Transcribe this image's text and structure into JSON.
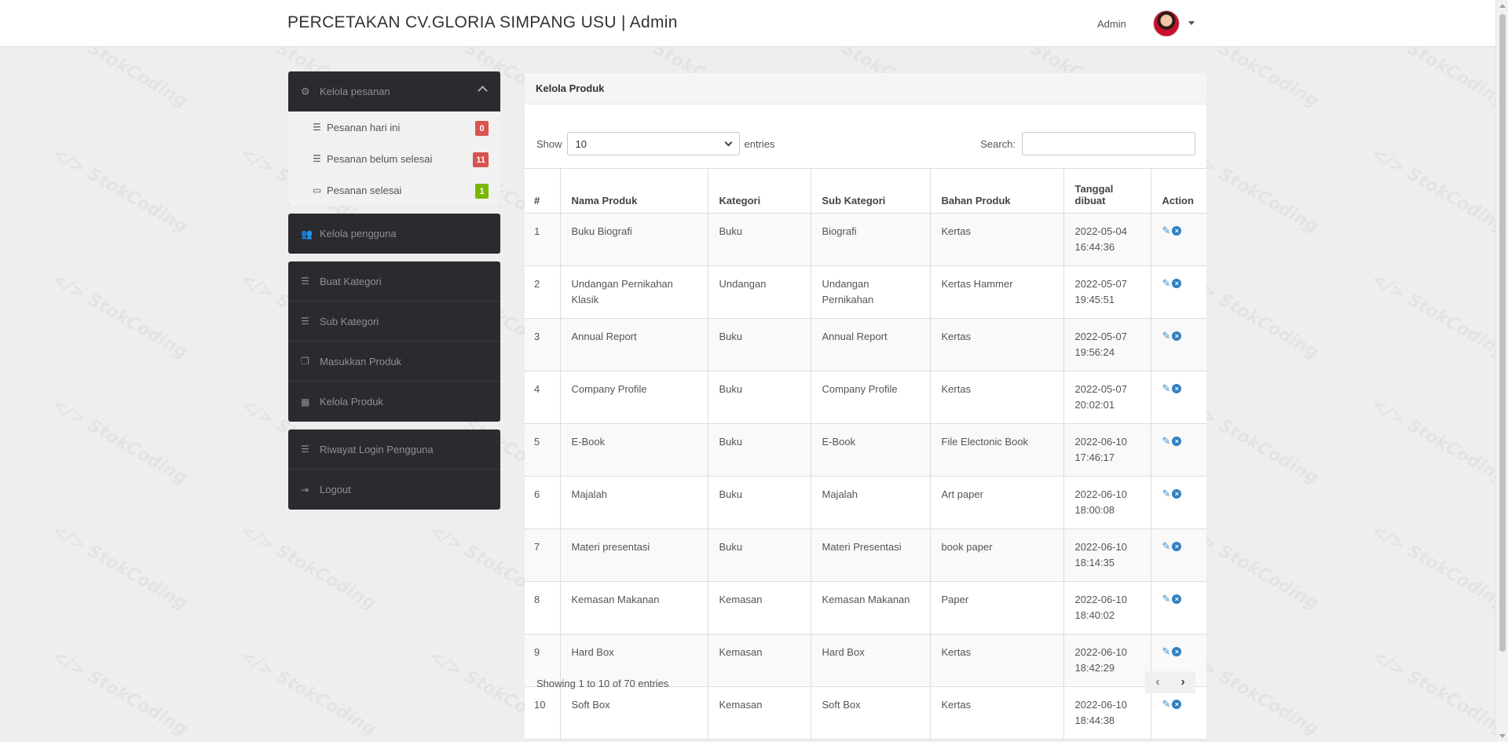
{
  "header": {
    "brand": "PERCETAKAN CV.GLORIA SIMPANG USU | Admin",
    "user": "Admin"
  },
  "watermark": "</> StokCoding",
  "sidebar": {
    "orders": {
      "label": "Kelola pesanan",
      "icon": "gear-icon",
      "items": [
        {
          "label": "Pesanan hari ini",
          "badge": "0",
          "badge_color": "#d9534f",
          "icon": "list-icon"
        },
        {
          "label": "Pesanan belum selesai",
          "badge": "11",
          "badge_color": "#d9534f",
          "icon": "list-icon"
        },
        {
          "label": "Pesanan selesai",
          "badge": "1",
          "badge_color": "#7ab800",
          "icon": "inbox-icon"
        }
      ]
    },
    "users": {
      "label": "Kelola pengguna",
      "icon": "users-icon"
    },
    "catalog": [
      {
        "label": "Buat Kategori",
        "icon": "list-icon"
      },
      {
        "label": "Sub Kategori",
        "icon": "list-icon"
      },
      {
        "label": "Masukkan Produk",
        "icon": "copy-icon"
      },
      {
        "label": "Kelola Produk",
        "icon": "table-icon"
      }
    ],
    "account": [
      {
        "label": "Riwayat Login Pengguna",
        "icon": "list-icon"
      },
      {
        "label": "Logout",
        "icon": "logout-icon"
      }
    ]
  },
  "main": {
    "title": "Kelola Produk",
    "show_label": "Show",
    "entries_value": "10",
    "entries_label": "entries",
    "search_label": "Search:",
    "search_value": "",
    "columns": [
      "#",
      "Nama Produk",
      "Kategori",
      "Sub Kategori",
      "Bahan Produk",
      "Tanggal dibuat",
      "Action"
    ],
    "rows": [
      {
        "no": "1",
        "nama": "Buku Biografi",
        "kategori": "Buku",
        "sub": "Biografi",
        "bahan": "Kertas",
        "tanggal": "2022-05-04 16:44:36"
      },
      {
        "no": "2",
        "nama": "Undangan Pernikahan Klasik",
        "kategori": "Undangan",
        "sub": "Undangan Pernikahan",
        "bahan": "Kertas Hammer",
        "tanggal": "2022-05-07 19:45:51"
      },
      {
        "no": "3",
        "nama": "Annual Report",
        "kategori": "Buku",
        "sub": "Annual Report",
        "bahan": "Kertas",
        "tanggal": "2022-05-07 19:56:24"
      },
      {
        "no": "4",
        "nama": "Company Profile",
        "kategori": "Buku",
        "sub": "Company Profile",
        "bahan": "Kertas",
        "tanggal": "2022-05-07 20:02:01"
      },
      {
        "no": "5",
        "nama": "E-Book",
        "kategori": "Buku",
        "sub": "E-Book",
        "bahan": "File Electonic Book",
        "tanggal": "2022-06-10 17:46:17"
      },
      {
        "no": "6",
        "nama": "Majalah",
        "kategori": "Buku",
        "sub": "Majalah",
        "bahan": "Art paper",
        "tanggal": "2022-06-10 18:00:08"
      },
      {
        "no": "7",
        "nama": "Materi presentasi",
        "kategori": "Buku",
        "sub": "Materi Presentasi",
        "bahan": "book paper",
        "tanggal": "2022-06-10 18:14:35"
      },
      {
        "no": "8",
        "nama": "Kemasan Makanan",
        "kategori": "Kemasan",
        "sub": "Kemasan Makanan",
        "bahan": "Paper",
        "tanggal": "2022-06-10 18:40:02"
      },
      {
        "no": "9",
        "nama": "Hard Box",
        "kategori": "Kemasan",
        "sub": "Hard Box",
        "bahan": "Kertas",
        "tanggal": "2022-06-10 18:42:29"
      },
      {
        "no": "10",
        "nama": "Soft Box",
        "kategori": "Kemasan",
        "sub": "Soft Box",
        "bahan": "Kertas",
        "tanggal": "2022-06-10 18:44:38"
      }
    ],
    "info": "Showing 1 to 10 of 70 entries",
    "pager": {
      "prev": "‹",
      "next": "›"
    }
  }
}
